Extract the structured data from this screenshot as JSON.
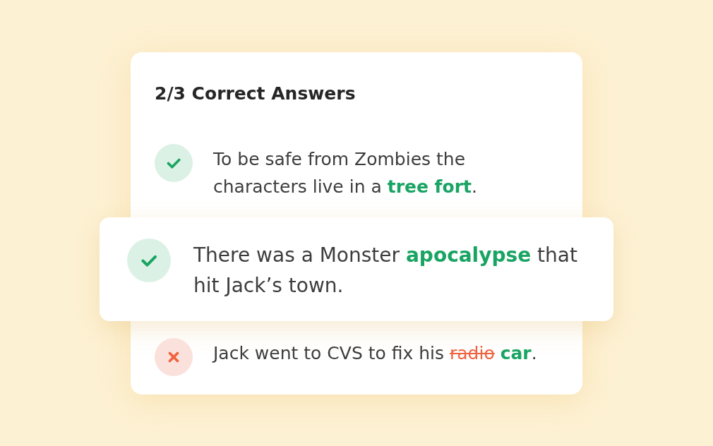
{
  "quiz_result": {
    "title": "2/3 Correct Answers",
    "answers": [
      {
        "correct": true,
        "highlighted": false,
        "segments": [
          {
            "kind": "plain",
            "text": "To be safe from Zombies the characters live in a **tree fort**."
          }
        ]
      },
      {
        "correct": true,
        "highlighted": true,
        "segments": [
          {
            "kind": "plain",
            "text": "There was a Monster **apocalypse** that hit Jack’s town."
          }
        ]
      },
      {
        "correct": false,
        "highlighted": false,
        "segments": [
          {
            "kind": "plain",
            "text": "Jack went to CVS to fix his "
          },
          {
            "kind": "struck",
            "text": "radio"
          },
          {
            "kind": "plain",
            "text": " **car**."
          }
        ]
      }
    ]
  }
}
